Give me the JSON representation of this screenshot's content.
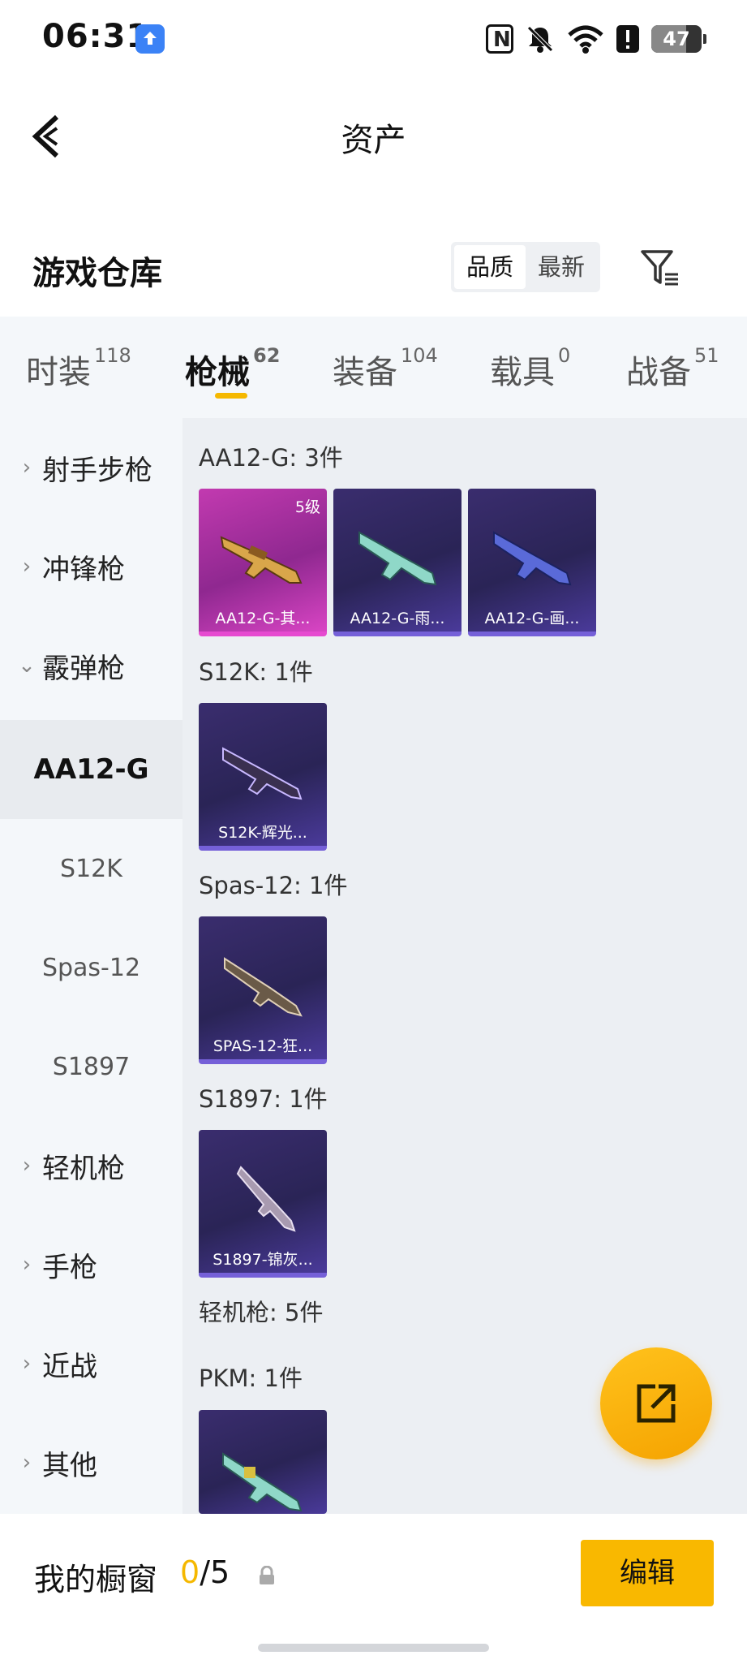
{
  "status_bar": {
    "time": "06:31",
    "battery": "47"
  },
  "header": {
    "title": "资产"
  },
  "warehouse": {
    "title": "游戏仓库",
    "sort_options": [
      "品质",
      "最新"
    ],
    "sort_selected": "品质"
  },
  "tabs": [
    {
      "label": "时装",
      "count": "118"
    },
    {
      "label": "枪械",
      "count": "62"
    },
    {
      "label": "装备",
      "count": "104"
    },
    {
      "label": "载具",
      "count": "0"
    },
    {
      "label": "战备",
      "count": "51"
    }
  ],
  "active_tab": "枪械",
  "sidebar": {
    "items": [
      {
        "label": "射手步枪",
        "kind": "category",
        "expanded": false
      },
      {
        "label": "冲锋枪",
        "kind": "category",
        "expanded": false
      },
      {
        "label": "霰弹枪",
        "kind": "category",
        "expanded": true
      },
      {
        "label": "AA12-G",
        "kind": "sub",
        "selected": true
      },
      {
        "label": "S12K",
        "kind": "sub",
        "selected": false
      },
      {
        "label": "Spas-12",
        "kind": "sub",
        "selected": false
      },
      {
        "label": "S1897",
        "kind": "sub",
        "selected": false
      },
      {
        "label": "轻机枪",
        "kind": "category",
        "expanded": false
      },
      {
        "label": "手枪",
        "kind": "category",
        "expanded": false
      },
      {
        "label": "近战",
        "kind": "category",
        "expanded": false
      },
      {
        "label": "其他",
        "kind": "category",
        "expanded": false
      }
    ]
  },
  "groups": [
    {
      "label": "AA12-G: 3件",
      "items": [
        {
          "name": "AA12-G-其...",
          "rarity": "pink",
          "level": "5级"
        },
        {
          "name": "AA12-G-雨...",
          "rarity": "purple"
        },
        {
          "name": "AA12-G-画...",
          "rarity": "purple"
        }
      ]
    },
    {
      "label": "S12K: 1件",
      "items": [
        {
          "name": "S12K-辉光...",
          "rarity": "purple"
        }
      ]
    },
    {
      "label": "Spas-12: 1件",
      "items": [
        {
          "name": "SPAS-12-狂...",
          "rarity": "purple"
        }
      ]
    },
    {
      "label": "S1897: 1件",
      "items": [
        {
          "name": "S1897-锦灰...",
          "rarity": "purple"
        }
      ]
    },
    {
      "label": "轻机枪: 5件",
      "items": []
    },
    {
      "label": "PKM: 1件",
      "items": [
        {
          "name": "",
          "rarity": "purple"
        }
      ]
    }
  ],
  "bottom": {
    "label": "我的橱窗",
    "current": "0",
    "total": "/5",
    "edit_label": "编辑"
  },
  "colors": {
    "accent": "#f9b800",
    "purple_card": "#2a2456",
    "pink_card": "#c23ab0"
  }
}
